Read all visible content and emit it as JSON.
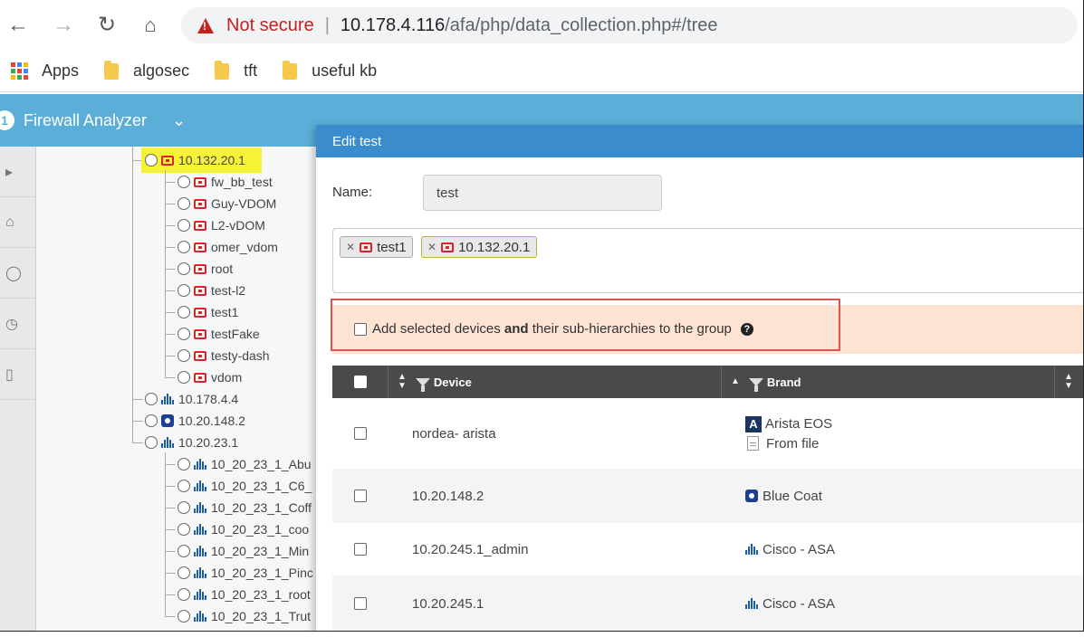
{
  "browser": {
    "security_label": "Not secure",
    "url_host": "10.178.4.116",
    "url_path": "/afa/php/data_collection.php#/tree",
    "bookmarks": [
      {
        "label": "Apps",
        "icon": "apps-grid-icon"
      },
      {
        "label": "algosec",
        "icon": "folder-icon"
      },
      {
        "label": "tft",
        "icon": "folder-icon"
      },
      {
        "label": "useful kb",
        "icon": "folder-icon"
      }
    ]
  },
  "app": {
    "title": "Firewall Analyzer",
    "logo_char": "1",
    "header_color": "#5aaed8"
  },
  "tree": {
    "items": [
      {
        "label": "10.132.20.1",
        "icon": "fortinet-icon",
        "level": 1,
        "highlight": true
      },
      {
        "label": "fw_bb_test",
        "icon": "fortinet-icon",
        "level": 2
      },
      {
        "label": "Guy-VDOM",
        "icon": "fortinet-icon",
        "level": 2
      },
      {
        "label": "L2-vDOM",
        "icon": "fortinet-icon",
        "level": 2
      },
      {
        "label": "omer_vdom",
        "icon": "fortinet-icon",
        "level": 2
      },
      {
        "label": "root",
        "icon": "fortinet-icon",
        "level": 2
      },
      {
        "label": "test-l2",
        "icon": "fortinet-icon",
        "level": 2
      },
      {
        "label": "test1",
        "icon": "fortinet-icon",
        "level": 2
      },
      {
        "label": "testFake",
        "icon": "fortinet-icon",
        "level": 2
      },
      {
        "label": "testy-dash",
        "icon": "fortinet-icon",
        "level": 2
      },
      {
        "label": "vdom",
        "icon": "fortinet-icon",
        "level": 2
      },
      {
        "label": "10.178.4.4",
        "icon": "cisco-icon",
        "level": 1
      },
      {
        "label": "10.20.148.2",
        "icon": "bluecoat-icon",
        "level": 1
      },
      {
        "label": "10.20.23.1",
        "icon": "cisco-icon",
        "level": 1
      },
      {
        "label": "10_20_23_1_Abu",
        "icon": "cisco-icon",
        "level": 2
      },
      {
        "label": "10_20_23_1_C6_",
        "icon": "cisco-icon",
        "level": 2
      },
      {
        "label": "10_20_23_1_Coff",
        "icon": "cisco-icon",
        "level": 2
      },
      {
        "label": "10_20_23_1_coo",
        "icon": "cisco-icon",
        "level": 2
      },
      {
        "label": "10_20_23_1_Min",
        "icon": "cisco-icon",
        "level": 2
      },
      {
        "label": "10_20_23_1_Pinc",
        "icon": "cisco-icon",
        "level": 2
      },
      {
        "label": "10_20_23_1_root",
        "icon": "cisco-icon",
        "level": 2
      },
      {
        "label": "10_20_23_1_Trut",
        "icon": "cisco-icon",
        "level": 2
      }
    ]
  },
  "modal": {
    "title": "Edit test",
    "name_label": "Name:",
    "name_value": "test",
    "tags": [
      {
        "label": "test1",
        "icon": "fortinet-icon",
        "highlight": false
      },
      {
        "label": "10.132.20.1",
        "icon": "fortinet-icon",
        "highlight": true
      }
    ],
    "sub_hier": {
      "text_pre": "Add selected devices ",
      "text_bold": "and",
      "text_post": " their sub-hierarchies to the group",
      "help": "?"
    },
    "columns": {
      "device": "Device",
      "brand": "Brand"
    },
    "rows": [
      {
        "device": "nordea- arista",
        "brands": [
          {
            "name": "Arista EOS",
            "icon": "arista-icon"
          },
          {
            "name": "From file",
            "icon": "file-icon"
          }
        ]
      },
      {
        "device": "10.20.148.2",
        "brands": [
          {
            "name": "Blue Coat",
            "icon": "bluecoat-icon"
          }
        ]
      },
      {
        "device": "10.20.245.1_admin",
        "brands": [
          {
            "name": "Cisco - ASA",
            "icon": "cisco-icon"
          }
        ]
      },
      {
        "device": "10.20.245.1",
        "brands": [
          {
            "name": "Cisco - ASA",
            "icon": "cisco-icon"
          }
        ]
      }
    ]
  }
}
